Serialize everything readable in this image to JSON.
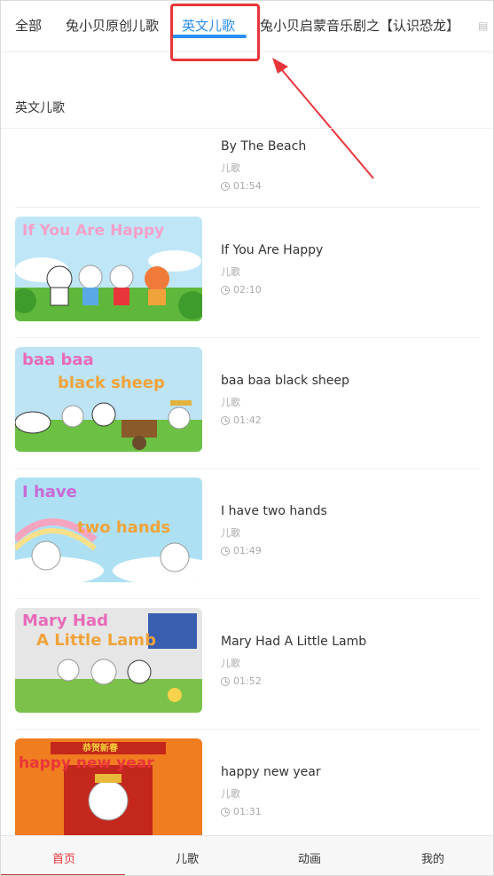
{
  "tabs": {
    "t0": "全部",
    "t1": "兔小贝原创儿歌",
    "t2": "英文儿歌",
    "t3": "兔小贝启蒙音乐剧之【认识恐龙】"
  },
  "section_title": "英文儿歌",
  "items": [
    {
      "title": "By The Beach",
      "category": "儿歌",
      "duration": "01:54"
    },
    {
      "title": "If You Are Happy",
      "category": "儿歌",
      "duration": "02:10",
      "thumb_text": "If You Are Happy"
    },
    {
      "title": "baa baa black sheep",
      "category": "儿歌",
      "duration": "01:42",
      "thumb_text_1": "baa baa",
      "thumb_text_2": "black sheep"
    },
    {
      "title": "I have two hands",
      "category": "儿歌",
      "duration": "01:49",
      "thumb_text_1": "I have",
      "thumb_text_2": "two hands"
    },
    {
      "title": "Mary Had A Little Lamb",
      "category": "儿歌",
      "duration": "01:52",
      "thumb_text_1": "Mary Had",
      "thumb_text_2": "A Little Lamb"
    },
    {
      "title": "happy new year",
      "category": "儿歌",
      "duration": "01:31",
      "thumb_text": "happy new year",
      "thumb_banner": "恭贺新春"
    }
  ],
  "bottom_nav": {
    "home": "首页",
    "songs": "儿歌",
    "animation": "动画",
    "mine": "我的"
  },
  "colors": {
    "accent_blue": "#2b8ff0",
    "highlight_red": "#e8353a",
    "nav_active": "#e8353a"
  }
}
